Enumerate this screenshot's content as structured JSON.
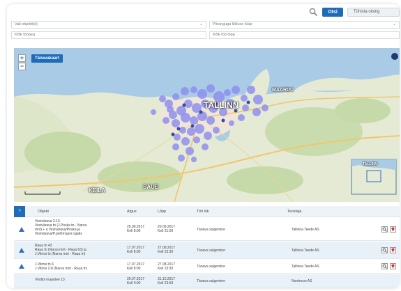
{
  "toolbar": {
    "search_label": "Otsi",
    "clear_label": "Tühista otsing"
  },
  "filters": {
    "object_type": "Vali objekti(d)",
    "closure_type": "Piiranguga liikluse tüüp",
    "start_date_placeholder": "Kõik tööaeg",
    "end_date_placeholder": "Kõik töö lõpp"
  },
  "map": {
    "mode_label": "Tänavakaart",
    "zoom_in": "+",
    "zoom_out": "−",
    "labels": {
      "tallinn": "TALLINN",
      "maardu": "MAARDU",
      "keila": "KEILA",
      "saue": "SAUE",
      "inset": "TALLINN"
    },
    "colors": {
      "sea": "#a9cbe6",
      "land": "#e6ecd6",
      "marker": "#8f8ff0"
    }
  },
  "table": {
    "headers": [
      "Objekt",
      "Algus",
      "Lõpp",
      "Töö liik",
      "Teostaja"
    ],
    "corner_label": "?",
    "rows": [
      {
        "objekt": [
          "Vesivärava 2-16",
          "Vesivärava tn (J.Poska tn - Narva",
          "mnt) + a Vesivärava/Poska ja",
          "Vesivärava/P.pehtmaavi rajatis"
        ],
        "algus": [
          "20.06.2017",
          "Kell 8:00"
        ],
        "lopp": [
          "20.09.2017",
          "Kell 21:00"
        ],
        "too": "Tänava sulgemine",
        "teostaja": "Tallinna Teede AS"
      },
      {
        "objekt": [
          "Raua tn 43",
          "Raua tn (Narva mnt - Raua 63) ja",
          "J.Vilmsi tn (Narva mnt - Raua tn)"
        ],
        "algus": [
          "17.07.2017",
          "Kell 8:00"
        ],
        "lopp": [
          "27.08.2017",
          "Kell 23:30"
        ],
        "too": "Tänava sulgemine",
        "teostaja": "Tallinna Teede AS"
      },
      {
        "objekt": [
          "J.Vilmsi tn 6",
          "J.Vilmsi 2-8 (Narva mnt - Raua tn)"
        ],
        "algus": [
          "17.07.2017",
          "Kell 8:00"
        ],
        "lopp": [
          "27.08.2017",
          "Kell 23:30"
        ],
        "too": "Tänava sulgemine",
        "teostaja": "Tallinna Teede AS"
      },
      {
        "objekt": [
          "Vindioi maantee 13"
        ],
        "algus": [
          "29.07.2017",
          "Kell 0:00"
        ],
        "lopp": [
          "31.10.2017",
          "Kell 23:59"
        ],
        "too": "Tänava sulgemine",
        "teostaja": "Nordecon AS"
      }
    ]
  }
}
